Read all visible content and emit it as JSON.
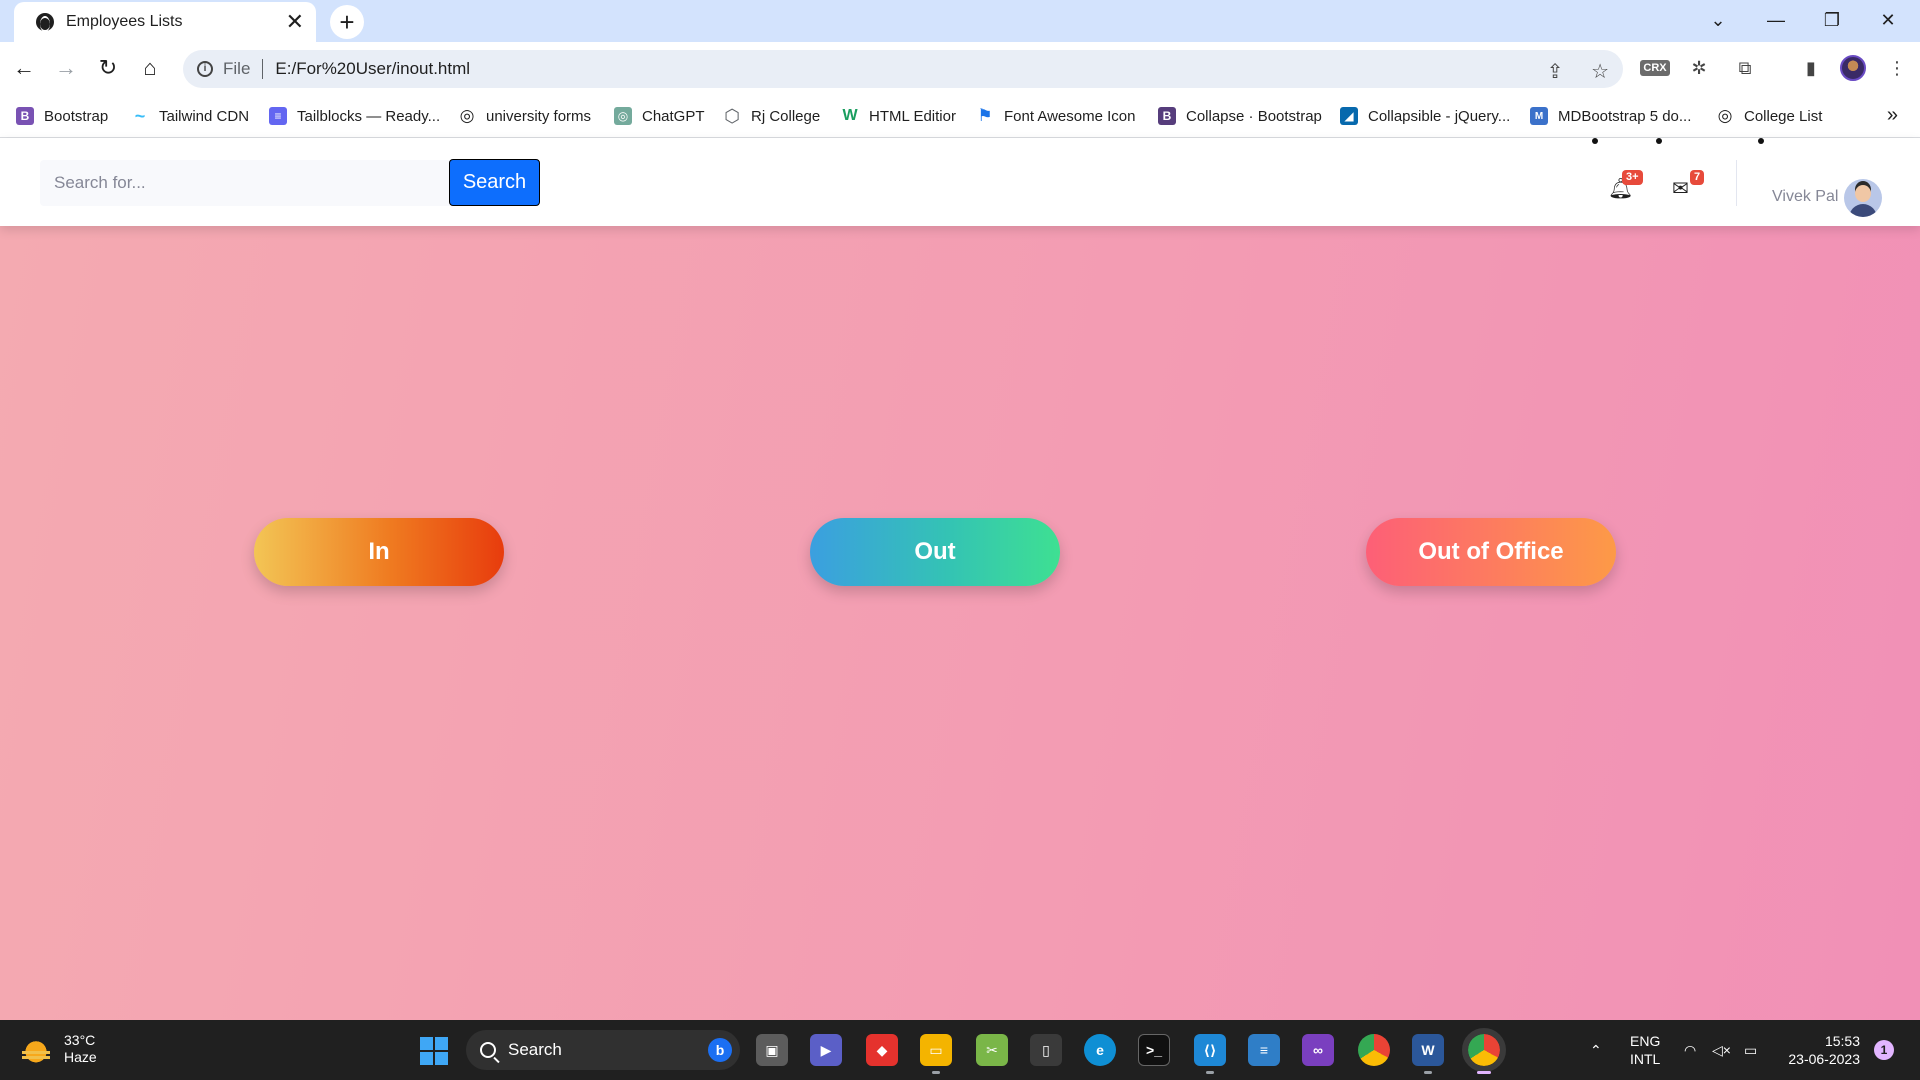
{
  "browser": {
    "tab_title": "Employees Lists",
    "tab_close": "✕",
    "new_tab": "+",
    "address_scheme": "File",
    "address_url": "E:/For%20User/inout.html",
    "bookmarks": [
      {
        "label": "Bootstrap",
        "icon": "bootstrap-icon",
        "color": "#7952b3",
        "glyph": "B"
      },
      {
        "label": "Tailwind CDN",
        "icon": "tailwind-icon",
        "color": "#38bdf8",
        "glyph": "~"
      },
      {
        "label": "Tailblocks — Ready...",
        "icon": "tailblocks-icon",
        "color": "#6366f1",
        "glyph": "≡"
      },
      {
        "label": "university forms",
        "icon": "openai-icon",
        "color": "#1f1f1f",
        "glyph": "◎"
      },
      {
        "label": "ChatGPT",
        "icon": "chatgpt-icon",
        "color": "#74aa9c",
        "glyph": "◎"
      },
      {
        "label": "Rj College",
        "icon": "hexagon-icon",
        "color": "#5f6368",
        "glyph": "⬡"
      },
      {
        "label": "HTML Editior",
        "icon": "w-logo-icon",
        "color": "#1a9e5f",
        "glyph": "W"
      },
      {
        "label": "Font Awesome Icon",
        "icon": "flag-icon",
        "color": "#1a73e8",
        "glyph": "⚑"
      },
      {
        "label": "Collapse · Bootstrap",
        "icon": "bootstrap-dark-icon",
        "color": "#563d7c",
        "glyph": "B"
      },
      {
        "label": "Collapsible - jQuery...",
        "icon": "jquery-icon",
        "color": "#0769ad",
        "glyph": "◢"
      },
      {
        "label": "MDBootstrap 5 do...",
        "icon": "mdb-icon",
        "color": "#3b71ca",
        "glyph": "M"
      },
      {
        "label": "College List",
        "icon": "openai-icon",
        "color": "#1f1f1f",
        "glyph": "◎"
      }
    ],
    "bookmarks_more": "»"
  },
  "appbar": {
    "search_placeholder": "Search for...",
    "search_button": "Search",
    "alerts_badge": "3+",
    "messages_badge": "7",
    "username": "Vivek Pal"
  },
  "actions": {
    "in_label": "In",
    "out_label": "Out",
    "ooo_label": "Out of Office"
  },
  "taskbar": {
    "temperature": "33°C",
    "weather": "Haze",
    "search_label": "Search",
    "lang_top": "ENG",
    "lang_bottom": "INTL",
    "time": "15:53",
    "date": "23-06-2023",
    "notifications": "1"
  }
}
